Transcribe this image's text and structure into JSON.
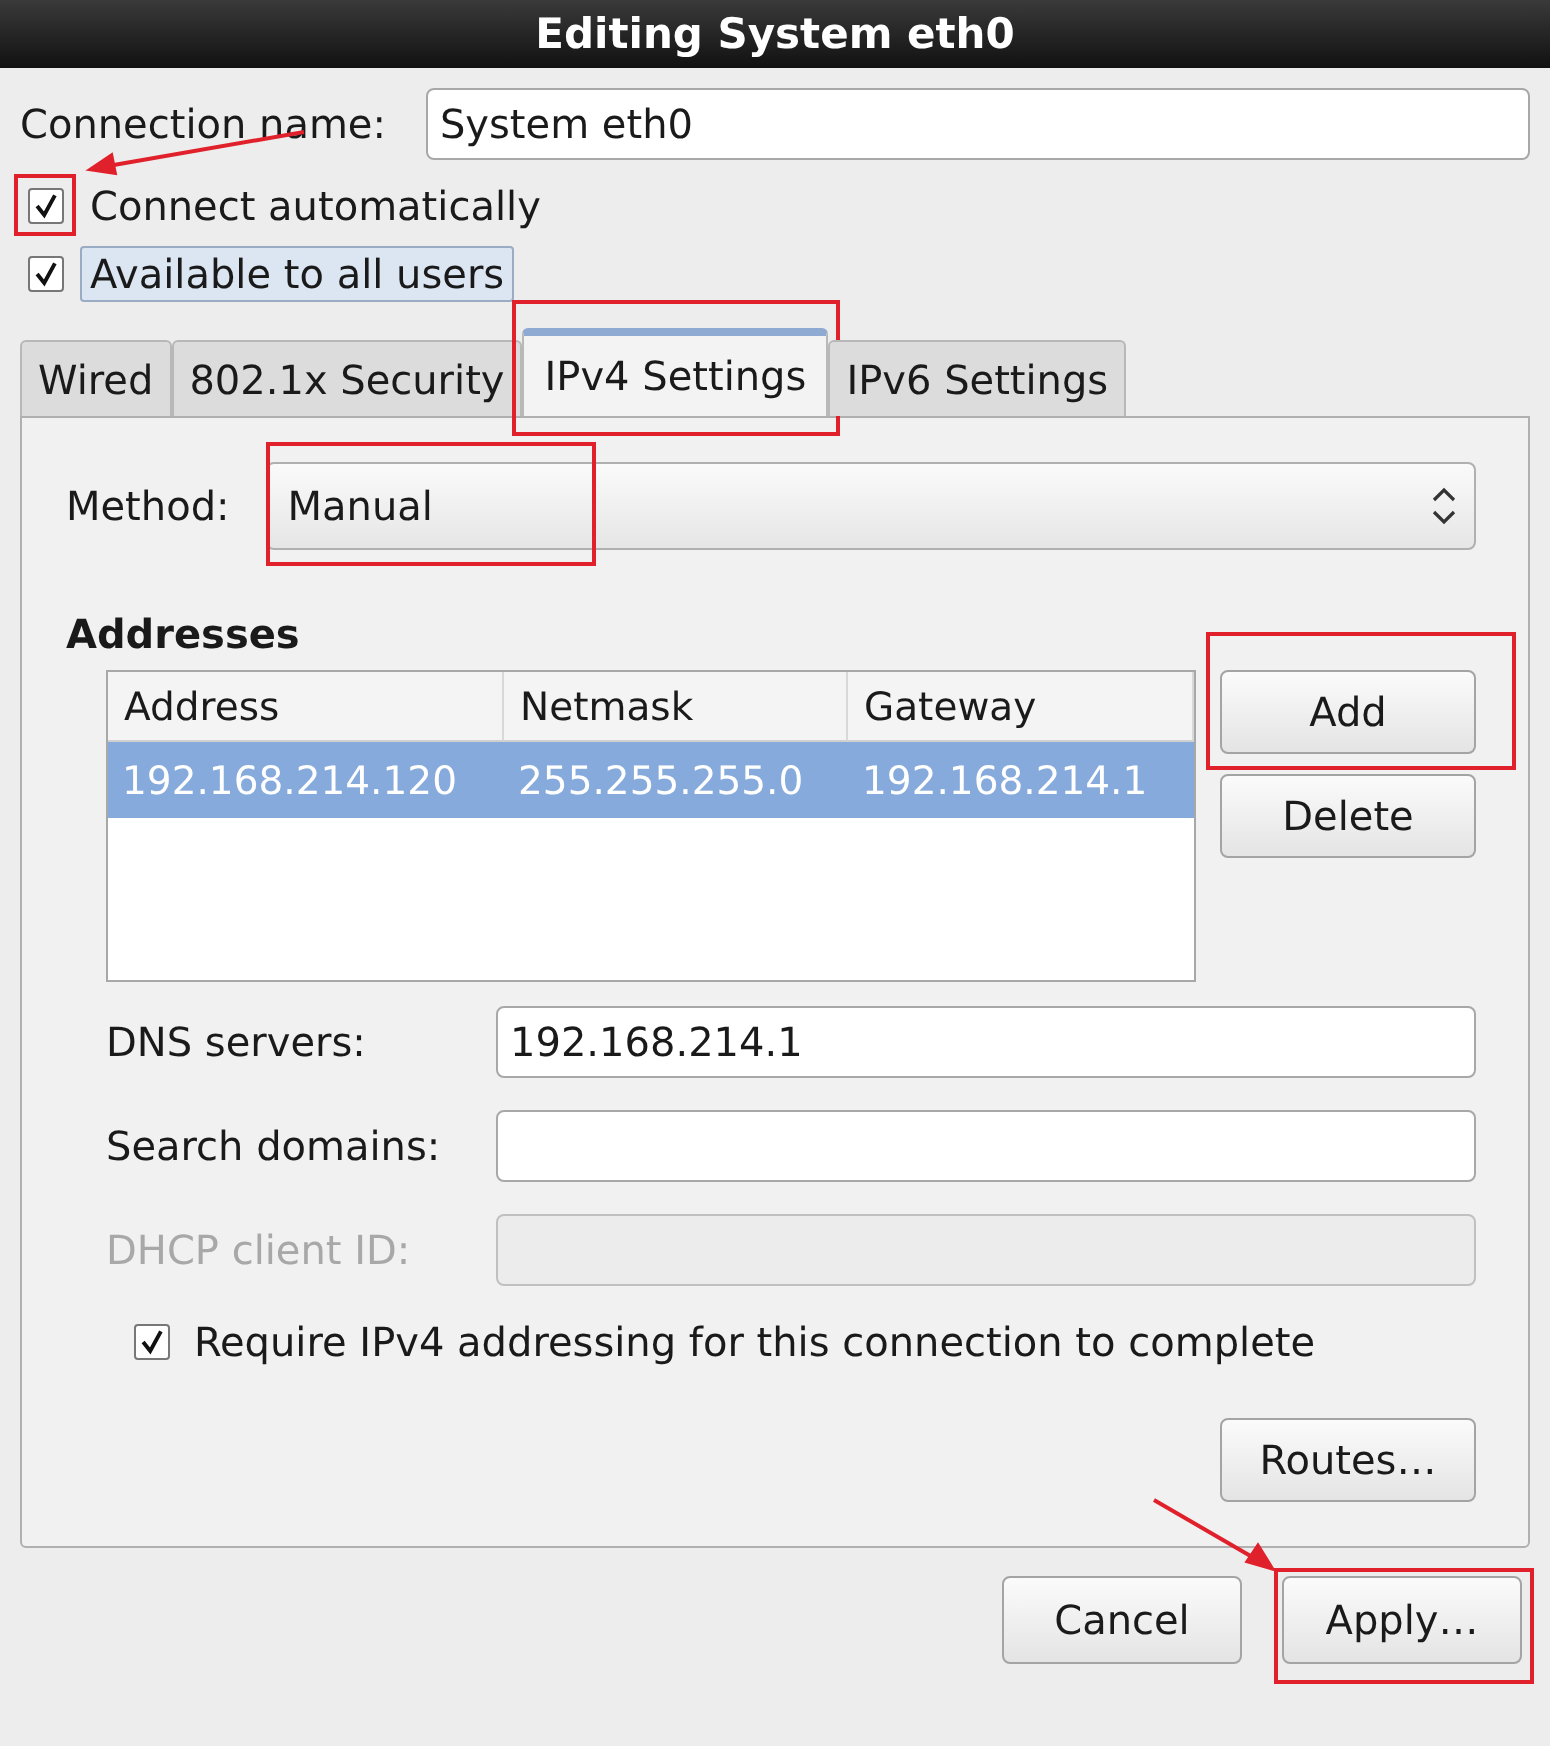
{
  "window": {
    "title": "Editing System eth0"
  },
  "connection_name": {
    "label": "Connection name:",
    "value": "System eth0"
  },
  "options": [
    {
      "label": "Connect automatically",
      "checked": true,
      "focused": false,
      "annotated": true,
      "arrow": true
    },
    {
      "label": "Available to all users",
      "checked": true,
      "focused": true,
      "annotated": false,
      "arrow": false
    }
  ],
  "tabs": [
    {
      "label": "Wired",
      "selected": false,
      "annotated": false
    },
    {
      "label": "802.1x Security",
      "selected": false,
      "annotated": false
    },
    {
      "label": "IPv4 Settings",
      "selected": true,
      "annotated": true
    },
    {
      "label": "IPv6 Settings",
      "selected": false,
      "annotated": false
    }
  ],
  "method": {
    "label": "Method:",
    "value": "Manual",
    "annotated": true
  },
  "addresses": {
    "heading": "Addresses",
    "columns": [
      "Address",
      "Netmask",
      "Gateway"
    ],
    "rows": [
      {
        "cells": [
          "192.168.214.120",
          "255.255.255.0",
          "192.168.214.1"
        ],
        "selected": true
      }
    ]
  },
  "address_buttons": [
    {
      "label": "Add",
      "annotated": true
    },
    {
      "label": "Delete",
      "annotated": false
    }
  ],
  "fields": [
    {
      "label": "DNS servers:",
      "value": "192.168.214.1",
      "disabled": false
    },
    {
      "label": "Search domains:",
      "disabled": false
    },
    {
      "label": "DHCP client ID:",
      "disabled": true
    }
  ],
  "require": {
    "label": "Require IPv4 addressing for this connection to complete",
    "checked": true
  },
  "routes_button": {
    "label": "Routes…"
  },
  "dialog_buttons": [
    {
      "label": "Cancel",
      "annotated": false,
      "arrow": false
    },
    {
      "label": "Apply…",
      "annotated": true,
      "arrow": true
    }
  ]
}
